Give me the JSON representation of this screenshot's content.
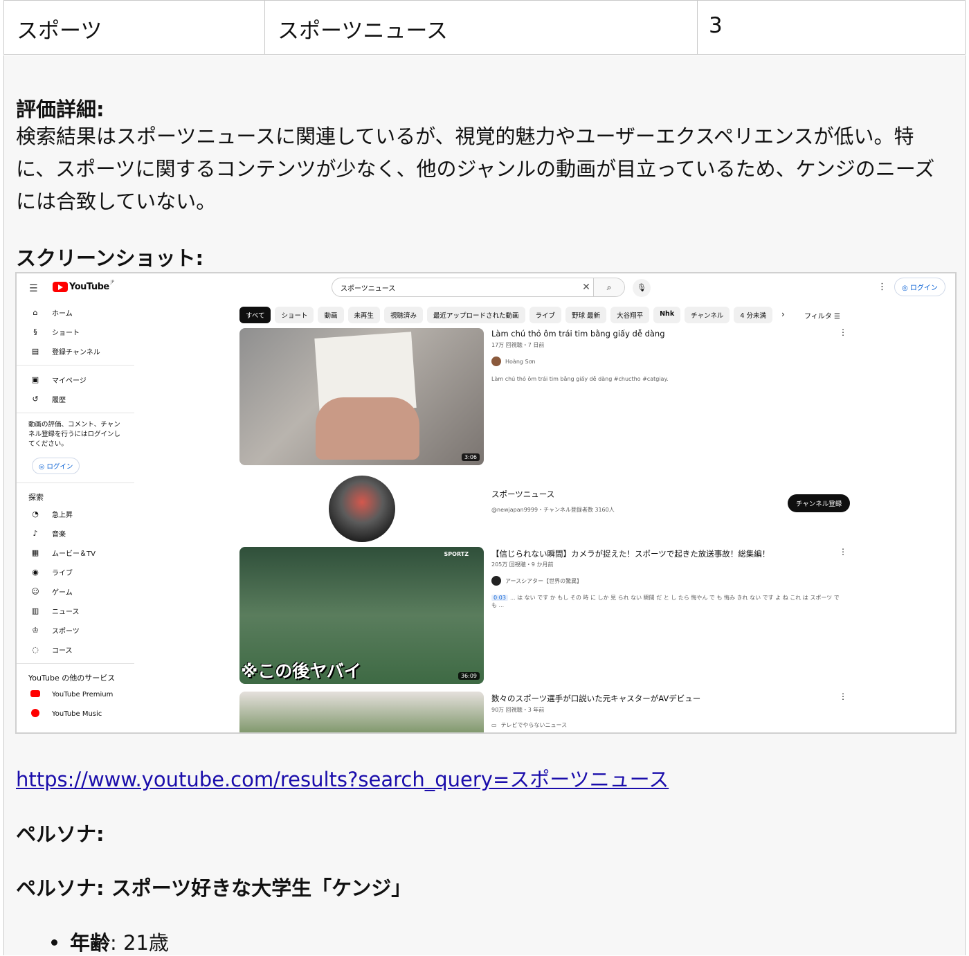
{
  "table_row": {
    "category": "スポーツ",
    "query": "スポーツニュース",
    "score": "3"
  },
  "detail": {
    "heading": "評価詳細:",
    "text": "検索結果はスポーツニュースに関連しているが、視覚的魅力やユーザーエクスペリエンスが低い。特に、スポーツに関するコンテンツが少なく、他のジャンルの動画が目立っているため、ケンジのニーズには合致していない。"
  },
  "screenshot_heading": "スクリーンショット:",
  "url": "https://www.youtube.com/results?search_query=スポーツニュース",
  "persona_heading": "ペルソナ:",
  "persona_title": "ペルソナ: スポーツ好きな大学生「ケンジ」",
  "persona_items": [
    {
      "key": "年齢",
      "value": ": 21歳"
    }
  ],
  "youtube": {
    "logo_text": "YouTube",
    "region": "JP",
    "search_query": "スポーツニュース",
    "login": "ログイン",
    "sidebar_main": [
      {
        "icon": "home-icon",
        "glyph": "⌂",
        "label": "ホーム"
      },
      {
        "icon": "shorts-icon",
        "glyph": "§",
        "label": "ショート"
      },
      {
        "icon": "subscriptions-icon",
        "glyph": "▤",
        "label": "登録チャンネル"
      }
    ],
    "sidebar_you": [
      {
        "icon": "my-page-icon",
        "glyph": "▣",
        "label": "マイページ"
      },
      {
        "icon": "history-icon",
        "glyph": "↺",
        "label": "履歴"
      }
    ],
    "sidebar_note": "動画の評価、コメント、チャンネル登録を行うにはログインしてください。",
    "explore_heading": "探索",
    "sidebar_explore": [
      {
        "icon": "trending-icon",
        "glyph": "◔",
        "label": "急上昇"
      },
      {
        "icon": "music-icon",
        "glyph": "♪",
        "label": "音楽"
      },
      {
        "icon": "movie-icon",
        "glyph": "▦",
        "label": "ムービー＆TV"
      },
      {
        "icon": "live-icon",
        "glyph": "◉",
        "label": "ライブ"
      },
      {
        "icon": "game-icon",
        "glyph": "☺",
        "label": "ゲーム"
      },
      {
        "icon": "news-icon",
        "glyph": "▥",
        "label": "ニュース"
      },
      {
        "icon": "sports-icon",
        "glyph": "♔",
        "label": "スポーツ"
      },
      {
        "icon": "course-icon",
        "glyph": "◌",
        "label": "コース"
      }
    ],
    "other_services_heading": "YouTube の他のサービス",
    "other_services": [
      {
        "icon": "youtube-premium-icon",
        "label": "YouTube Premium",
        "color": "#ff0000"
      },
      {
        "icon": "youtube-music-icon",
        "label": "YouTube Music",
        "color": "#ff0000"
      }
    ],
    "chips": [
      "すべて",
      "ショート",
      "動画",
      "未再生",
      "視聴済み",
      "最近アップロードされた動画",
      "ライブ",
      "野球 最新",
      "大谷翔平",
      "Nhk",
      "チャンネル",
      "4 分未満"
    ],
    "filter_label": "フィルタ",
    "videos": [
      {
        "title": "Làm chú thỏ ôm trái tim bằng giấy dễ dàng",
        "meta": "17万 回視聴・7 日前",
        "channel": "Hoàng Sơn",
        "desc": "Làm chú thỏ ôm trái tim bằng giấy dễ dàng #chuctho #catgiay.",
        "duration": "3:06"
      },
      {
        "title": "【信じられない瞬間】カメラが捉えた！スポーツで起きた放送事故！総集編！",
        "meta": "205万 回視聴・9 か月前",
        "channel": "アースシアター【世界の驚異】",
        "timestamp": "0:03",
        "desc": "... は ない です か もし その 時 に しか 見 られ ない 瞬間 だ と し たら 悔やん で も 悔み きれ ない です よ ね これ は スポーツ で も ...",
        "duration": "36:09",
        "overlay": "※この後ヤバイ",
        "badge": "SPORTZ"
      },
      {
        "title": "数々のスポーツ選手が口説いた元キャスターがAVデビュー",
        "meta": "90万 回視聴・3 年前",
        "channel": "テレビでやらないニュース"
      }
    ],
    "channel_result": {
      "name": "スポーツニュース",
      "meta": "@newjapan9999・チャンネル登録者数 3160人",
      "subscribe": "チャンネル登録"
    }
  }
}
